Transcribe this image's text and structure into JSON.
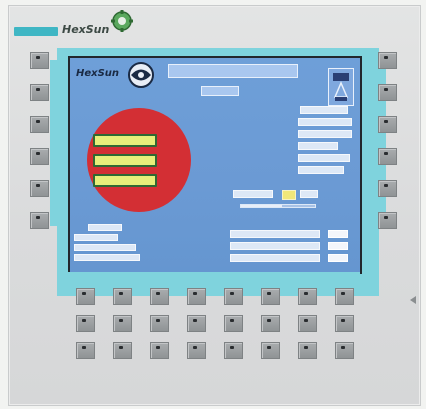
{
  "header": {
    "brand": "HexSun",
    "logo_icon": "gear-globe-logo"
  },
  "screen": {
    "brand": "HexSun",
    "title_box": "",
    "sub_box": "",
    "menu_icon": "key-icon",
    "right_list": [
      "",
      "",
      "",
      "",
      "",
      "",
      ""
    ],
    "circle_buttons": [
      "",
      "",
      ""
    ],
    "middle": {
      "field_left": "",
      "field_right": "",
      "progress": 0.55
    },
    "left_small": [
      "",
      "",
      "",
      ""
    ],
    "bottom_rows": [
      {
        "label": "",
        "value": ""
      },
      {
        "label": "",
        "value": ""
      },
      {
        "label": "",
        "value": ""
      }
    ]
  },
  "colors": {
    "panel": "#dadbdc",
    "frame_cyan": "#7fd3dd",
    "screen_blue": "#6b9ad4",
    "alarm_red": "#d32f34",
    "button_yellow": "#e7ef7a",
    "key_gray": "#9a9ea0"
  },
  "keys": {
    "left_column_count": 6,
    "right_column_count": 6,
    "bottom_grid_columns": 8,
    "bottom_grid_rows": 3
  }
}
